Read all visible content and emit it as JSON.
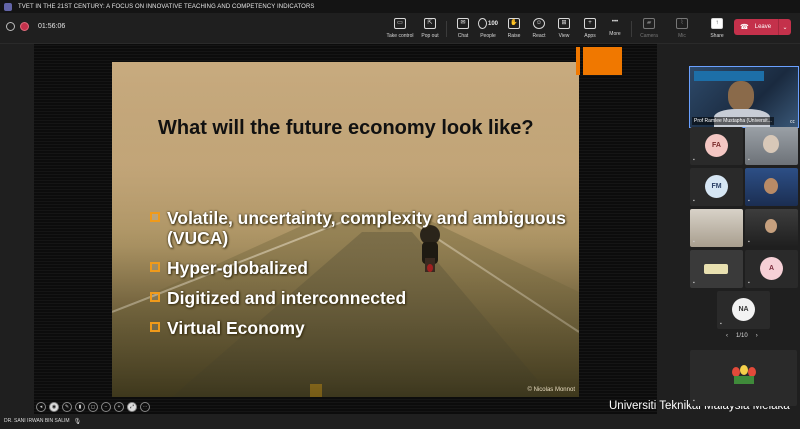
{
  "window": {
    "title": "TVET IN THE 21ST CENTURY: A FOCUS ON INNOVATIVE TEACHING AND COMPETENCY INDICATORS"
  },
  "meeting": {
    "timer": "01:56:06"
  },
  "toolbar": {
    "take_control": "Take control",
    "pop_out": "Pop out",
    "chat": "Chat",
    "people": "People",
    "people_count": "100",
    "raise": "Raise",
    "react": "React",
    "view": "View",
    "apps": "Apps",
    "more": "More",
    "camera": "Camera",
    "mic": "Mic",
    "share": "Share",
    "leave": "Leave"
  },
  "slide": {
    "title": "What will the future economy look like?",
    "bullets": [
      "Volatile, uncertainty, complexity and ambiguous (VUCA)",
      "Hyper-globalized",
      "Digitized and interconnected",
      "Virtual Economy"
    ],
    "credit": "© Nicolas Monnot",
    "accent_color": "#f07800"
  },
  "presenter": {
    "name": "DR. SANI IRWAN BIN SALIM"
  },
  "watermark": "Universiti Teknikal Malaysia Melaka",
  "participants": {
    "featured_name": "Prof Ramlee Mustapha (Universit...",
    "initials": {
      "fa": "FA",
      "fm": "FM",
      "a": "A",
      "na": "NA"
    },
    "pager": {
      "prev": "‹",
      "label": "1/10",
      "next": "›"
    }
  },
  "colors": {
    "leave": "#c4314b",
    "accent": "#f07800",
    "highlight_border": "#6aa0ff"
  }
}
